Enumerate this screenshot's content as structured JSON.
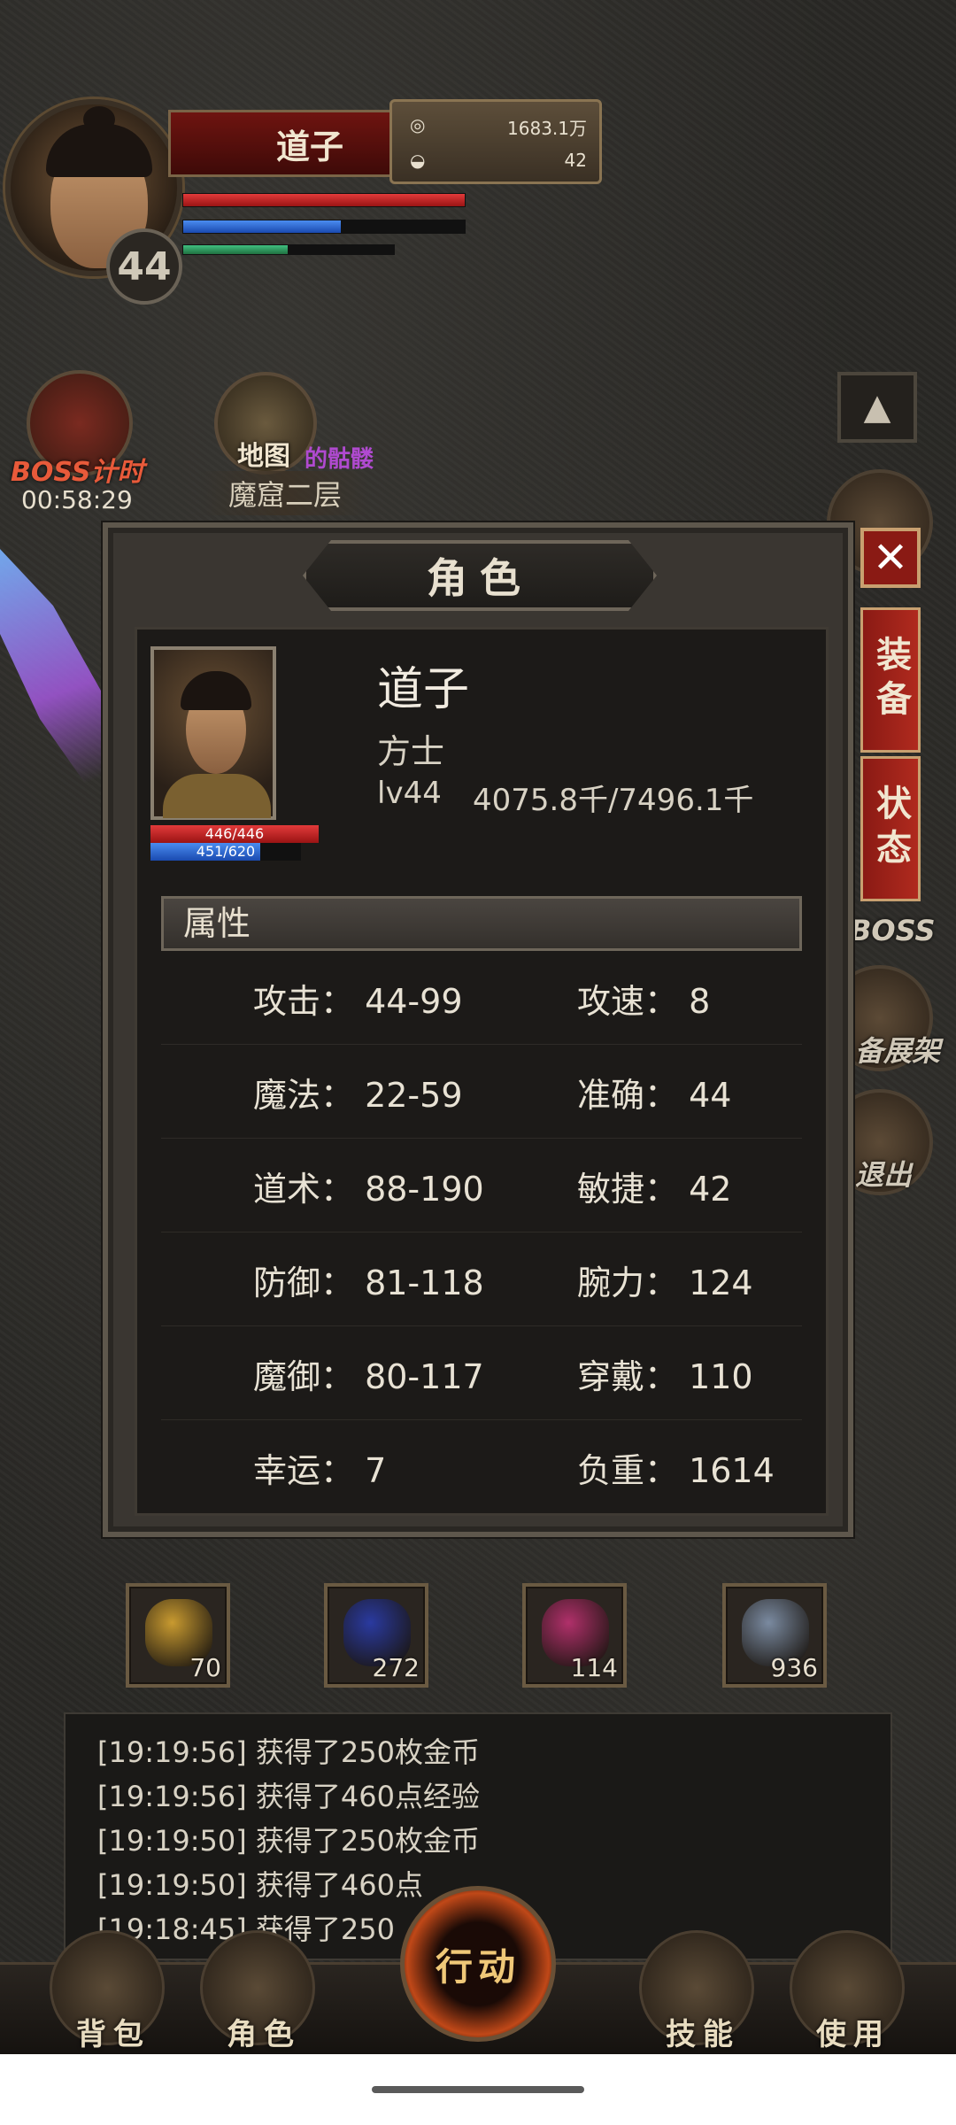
{
  "player": {
    "name": "道子",
    "level": "44",
    "gold": "1683.1万",
    "ingot": "42"
  },
  "hud": {
    "boss_timer_label": "BOSS计时",
    "boss_timer": "00:58:29",
    "map_label": "地图",
    "map_extra": "的骷髅",
    "floor": "魔窟二层",
    "right_labels": [
      "BOSS",
      "备展架",
      "退出"
    ]
  },
  "panel": {
    "title": "角色",
    "close": "✕",
    "side_tabs": [
      "装备",
      "状态"
    ],
    "character": {
      "name": "道子",
      "class": "方士",
      "level": "lv44",
      "exp": "4075.8千/7496.1千",
      "hp": "446/446",
      "mp": "451/620",
      "mp_fraction": 0.727
    },
    "attr_header": "属性",
    "stats": [
      [
        "攻击：  44-99",
        "攻速：  8"
      ],
      [
        "魔法：  22-59",
        "准确：  44"
      ],
      [
        "道术：  88-190",
        "敏捷：  42"
      ],
      [
        "防御：  81-118",
        "腕力：  124"
      ],
      [
        "魔御：  80-117",
        "穿戴：  110"
      ],
      [
        "幸运：  7",
        "负重：  1614"
      ]
    ]
  },
  "items": [
    {
      "count": "70",
      "color": "#c89a30"
    },
    {
      "count": "272",
      "color": "#2a3aa0"
    },
    {
      "count": "114",
      "color": "#b0306a"
    },
    {
      "count": "936",
      "color": "#7a8aa0"
    }
  ],
  "log": [
    "[19:19:56] 获得了250枚金币",
    "[19:19:56] 获得了460点经验",
    "[19:19:50] 获得了250枚金币",
    "[19:19:50] 获得了460点",
    "[19:18:45] 获得了250"
  ],
  "nav": {
    "bag": "背包",
    "role": "角色",
    "action": "行动",
    "skill": "技能",
    "use": "使用"
  }
}
